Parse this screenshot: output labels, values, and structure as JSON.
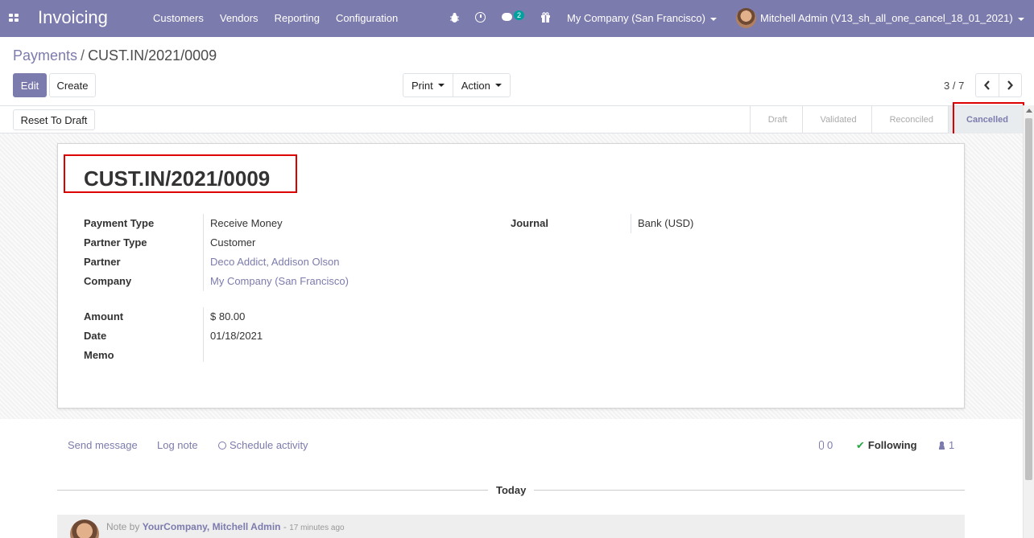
{
  "navbar": {
    "brand": "Invoicing",
    "menu": [
      "Customers",
      "Vendors",
      "Reporting",
      "Configuration"
    ],
    "chat_badge": "2",
    "company": "My Company (San Francisco)",
    "user": "Mitchell Admin (V13_sh_all_one_cancel_18_01_2021)"
  },
  "breadcrumb": {
    "parent": "Payments",
    "separator": "/",
    "current": "CUST.IN/2021/0009"
  },
  "toolbar": {
    "edit": "Edit",
    "create": "Create",
    "print": "Print",
    "action": "Action"
  },
  "pager": {
    "value": "3 / 7"
  },
  "statusbar": {
    "reset": "Reset To Draft",
    "stages": [
      "Draft",
      "Validated",
      "Reconciled",
      "Cancelled"
    ],
    "active_stage": "Cancelled"
  },
  "form": {
    "title": "CUST.IN/2021/0009",
    "fields": {
      "payment_type": {
        "label": "Payment Type",
        "value": "Receive Money"
      },
      "partner_type": {
        "label": "Partner Type",
        "value": "Customer"
      },
      "partner": {
        "label": "Partner",
        "value": "Deco Addict, Addison Olson"
      },
      "company": {
        "label": "Company",
        "value": "My Company (San Francisco)"
      },
      "amount": {
        "label": "Amount",
        "value": "$ 80.00"
      },
      "date": {
        "label": "Date",
        "value": "01/18/2021"
      },
      "memo": {
        "label": "Memo",
        "value": ""
      },
      "journal": {
        "label": "Journal",
        "value": "Bank (USD)"
      }
    }
  },
  "chatter": {
    "send_message": "Send message",
    "log_note": "Log note",
    "schedule_activity": "Schedule activity",
    "attachments": "0",
    "following": "Following",
    "followers": "1",
    "day": "Today",
    "message": {
      "prefix": "Note by",
      "author": "YourCompany, Mitchell Admin",
      "dash": "-",
      "time": "17 minutes ago"
    }
  },
  "colors": {
    "primary": "#7c7bad",
    "highlight": "#dd0000",
    "success": "#28a745"
  }
}
